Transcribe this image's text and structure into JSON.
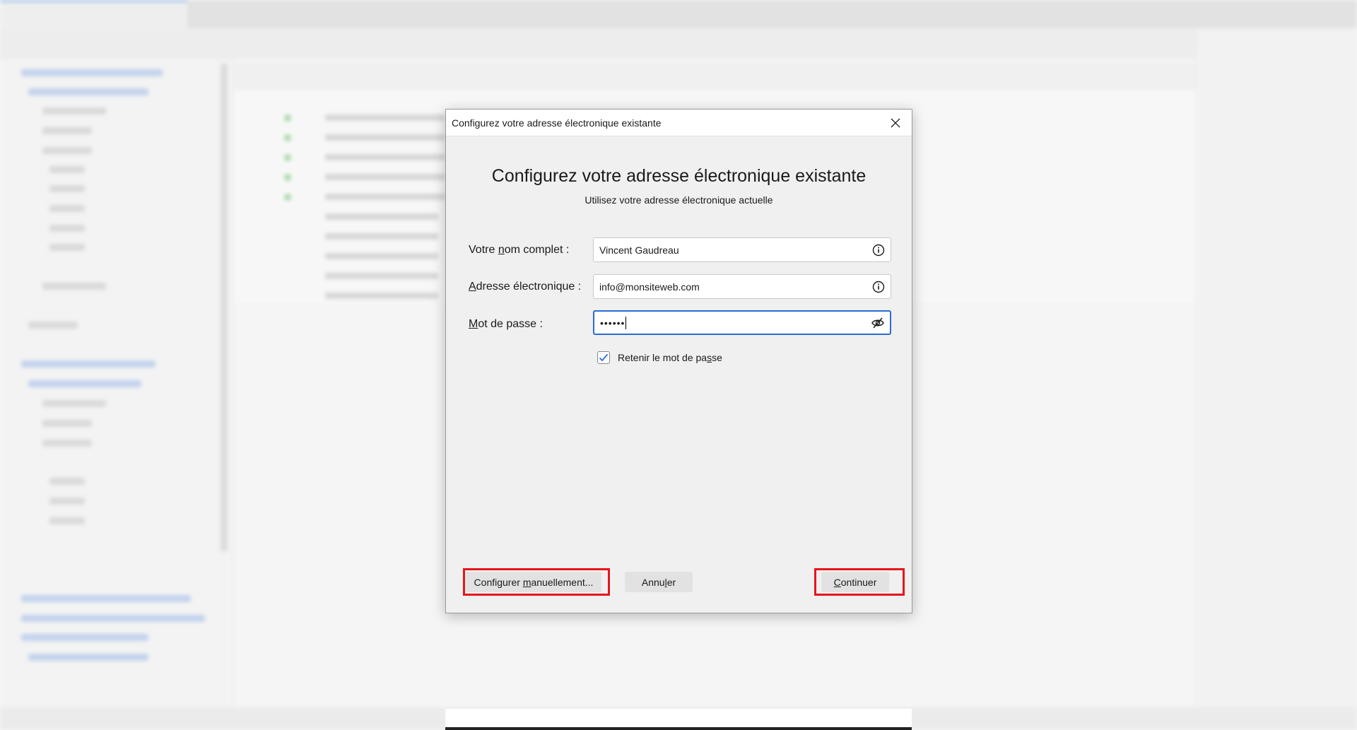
{
  "dialog": {
    "window_title": "Configurez votre adresse électronique existante",
    "heading": "Configurez votre adresse électronique existante",
    "subheading": "Utilisez votre adresse électronique actuelle",
    "fields": {
      "fullname_label": "Votre nom complet :",
      "fullname_value": "Vincent Gaudreau",
      "email_label": "Adresse électronique :",
      "email_value": "info@monsiteweb.com",
      "password_label": "Mot de passe :",
      "password_mask": "••••••"
    },
    "remember_password_label": "Retenir le mot de passe",
    "remember_password_checked": true,
    "buttons": {
      "manual": "Configurer manuellement...",
      "cancel": "Annuler",
      "continue": "Continuer"
    },
    "icons": {
      "close": "close-icon",
      "info": "info-icon",
      "password_visibility": "eye-slash-icon",
      "checkmark": "checkmark-icon"
    },
    "colors": {
      "focus_border": "#2a6bd3",
      "highlight": "#e8141c",
      "checkmark": "#2a6bd3"
    }
  }
}
